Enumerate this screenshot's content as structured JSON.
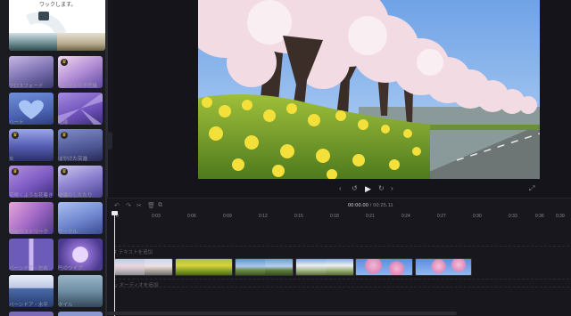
{
  "panel": {
    "preview_caption": "ワックします。",
    "transitions": [
      {
        "label": "クロスフェード",
        "premium": false
      },
      {
        "label": "デジタルの不思議",
        "premium": true
      },
      {
        "label": "ハート",
        "premium": false
      },
      {
        "label": "光線",
        "premium": false
      },
      {
        "label": "炎",
        "premium": true
      },
      {
        "label": "ぼやけた突進",
        "premium": true
      },
      {
        "label": "花咲くような花着き",
        "premium": true
      },
      {
        "label": "破壊のしたたり",
        "premium": true
      },
      {
        "label": "渦巻のストリーク",
        "premium": false
      },
      {
        "label": "サークル",
        "premium": false
      },
      {
        "label": "バーンドア・左右",
        "premium": false
      },
      {
        "label": "円のワイプ",
        "premium": false
      },
      {
        "label": "バーンドア・水平",
        "premium": false
      },
      {
        "label": "タイル",
        "premium": false
      }
    ]
  },
  "player": {
    "buttons": [
      "skip-back",
      "rewind-5",
      "play",
      "forward-5",
      "skip-forward"
    ],
    "fullscreen": "⤢"
  },
  "timeline": {
    "tools": [
      "undo",
      "redo",
      "cut",
      "delete",
      "duplicate"
    ],
    "timecode_current": "00:00.00",
    "timecode_separator": " / ",
    "timecode_total": "00:25.11",
    "ruler": [
      "0",
      "0:03",
      "0:06",
      "0:09",
      "0:12",
      "0:15",
      "0:18",
      "0:21",
      "0:24",
      "0:27",
      "0:30",
      "0:33",
      "0:36",
      "0:39"
    ],
    "text_track": "T  テキストを追加",
    "audio_track": "♫  オーディオを追加",
    "clips": [
      {
        "theme": "cherry-road"
      },
      {
        "theme": "rapeseed"
      },
      {
        "theme": "tree-sky"
      },
      {
        "theme": "white-blossom"
      },
      {
        "theme": "pink-blossom-sky"
      },
      {
        "theme": "pink-blossom-sky"
      }
    ]
  }
}
